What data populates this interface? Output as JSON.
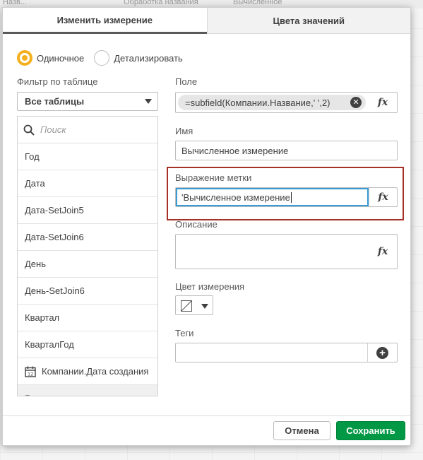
{
  "background": {
    "top_strip": [
      "Назв...",
      "Обработка названия",
      "Вычисленное"
    ]
  },
  "tabs": [
    {
      "label": "Изменить измерение",
      "active": true
    },
    {
      "label": "Цвета значений",
      "active": false
    }
  ],
  "mode": {
    "options": [
      {
        "label": "Одиночное",
        "selected": true
      },
      {
        "label": "Детализировать",
        "selected": false
      }
    ]
  },
  "table_filter": {
    "label": "Фильтр по таблице",
    "value": "Все таблицы"
  },
  "field_list": {
    "search_placeholder": "Поиск",
    "items": [
      {
        "label": "Год",
        "icon": null
      },
      {
        "label": "Дата",
        "icon": null
      },
      {
        "label": "Дата-SetJoin5",
        "icon": null
      },
      {
        "label": "Дата-SetJoin6",
        "icon": null
      },
      {
        "label": "День",
        "icon": null
      },
      {
        "label": "День-SetJoin6",
        "icon": null
      },
      {
        "label": "Квартал",
        "icon": null
      },
      {
        "label": "КварталГод",
        "icon": null
      },
      {
        "label": "Компании.Дата создания",
        "icon": "calendar-icon"
      },
      {
        "label": "Г",
        "icon": null
      }
    ]
  },
  "form": {
    "field": {
      "label": "Поле",
      "value": "=subfield(Компании.Название,' ',2)"
    },
    "name": {
      "label": "Имя",
      "value": "Вычисленное измерение"
    },
    "label_expression": {
      "label": "Выражение метки",
      "value": "'Вычисленное измерение"
    },
    "description": {
      "label": "Описание",
      "value": ""
    },
    "dimension_color": {
      "label": "Цвет измерения"
    },
    "tags": {
      "label": "Теги",
      "value": ""
    }
  },
  "footer": {
    "cancel_label": "Отмена",
    "save_label": "Сохранить"
  },
  "colors": {
    "accent_radio": "#f5b01f",
    "save_button": "#009845",
    "highlight_border": "#a6312b",
    "focus_border": "#3a9bd5"
  }
}
